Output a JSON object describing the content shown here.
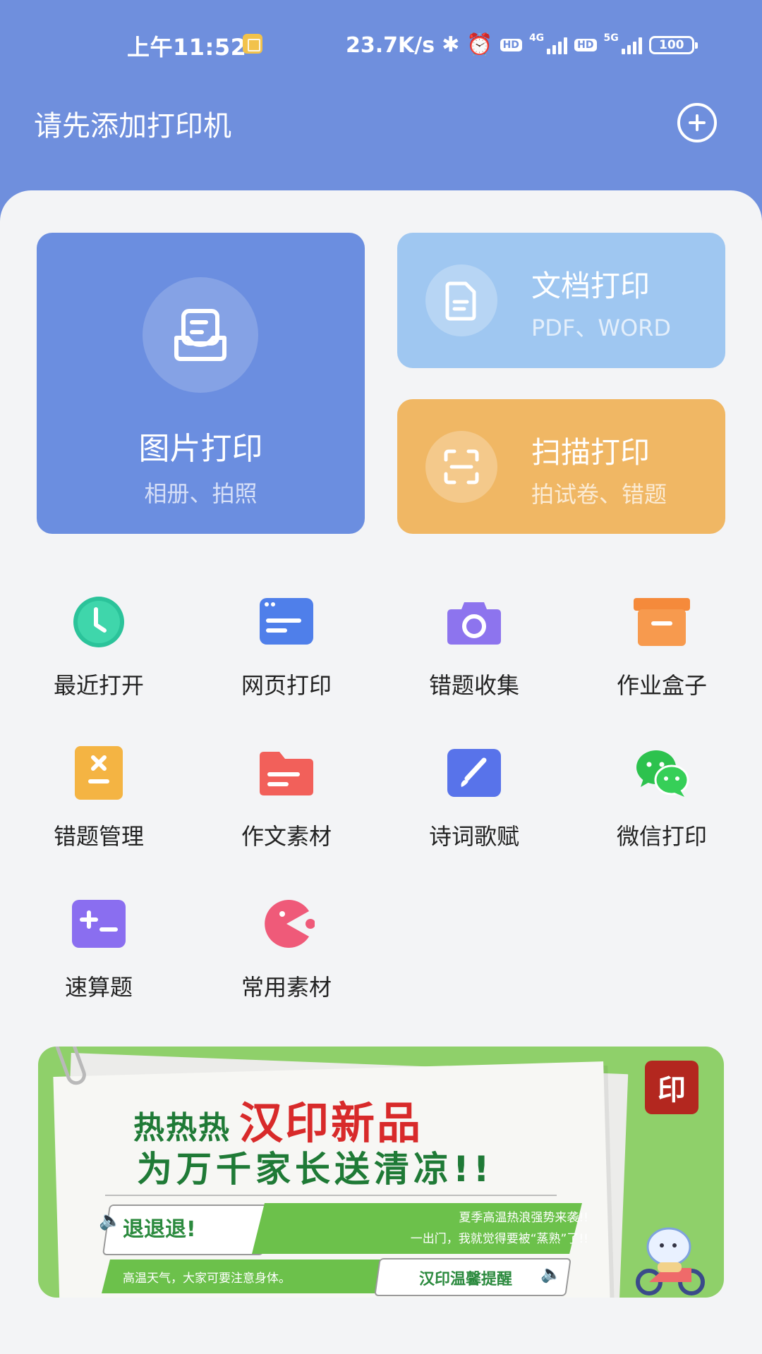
{
  "status_bar": {
    "time": "上午11:52",
    "net_speed": "23.7K/s",
    "sim1_badge": "HD",
    "sim1_network": "4G",
    "sim2_badge": "HD",
    "sim2_network": "5G",
    "battery": "100",
    "icons": [
      "notification-note-icon",
      "bluetooth-icon",
      "alarm-icon",
      "signal-icon",
      "battery-icon"
    ]
  },
  "header": {
    "title": "请先添加打印机",
    "add_icon": "plus-circle-icon"
  },
  "cards": {
    "photo": {
      "title": "图片打印",
      "subtitle": "相册、拍照",
      "icon": "photo-tray-icon",
      "color": "#6b8ee0"
    },
    "document": {
      "title": "文档打印",
      "subtitle": "PDF、WORD",
      "icon": "document-icon",
      "color": "#9fc7f1"
    },
    "scan": {
      "title": "扫描打印",
      "subtitle": "拍试卷、错题",
      "icon": "scan-frame-icon",
      "color": "#f0b764"
    }
  },
  "features": [
    {
      "label": "最近打开",
      "icon": "clock-icon",
      "color": "#2bc39a"
    },
    {
      "label": "网页打印",
      "icon": "browser-window-icon",
      "color": "#4f7fea"
    },
    {
      "label": "错题收集",
      "icon": "camera-icon",
      "color": "#8d74ee"
    },
    {
      "label": "作业盒子",
      "icon": "box-icon",
      "color": "#f58a3b"
    },
    {
      "label": "错题管理",
      "icon": "calculator-icon",
      "color": "#f4b443"
    },
    {
      "label": "作文素材",
      "icon": "folder-icon",
      "color": "#f2605a"
    },
    {
      "label": "诗词歌赋",
      "icon": "brush-icon",
      "color": "#5873ea"
    },
    {
      "label": "微信打印",
      "icon": "wechat-icon",
      "color": "#2dc24e"
    },
    {
      "label": "速算题",
      "icon": "plus-minus-icon",
      "color": "#8a6ef0"
    },
    {
      "label": "常用素材",
      "icon": "pacman-icon",
      "color": "#ef5a79"
    }
  ],
  "banner": {
    "hot": "热热热",
    "headline": "汉印新品",
    "line2": "为万千家长送清凉!!",
    "retreat": "退退退!",
    "msg_line1": "夏季高温热浪强势来袭!!",
    "msg_line2": "一出门，我就觉得要被“蒸熟”了!!",
    "msg_line3": "高温天气，大家可要注意身体。",
    "reminder": "汉印温馨提醒",
    "seal": "汉印",
    "color": "#8fd06a"
  }
}
